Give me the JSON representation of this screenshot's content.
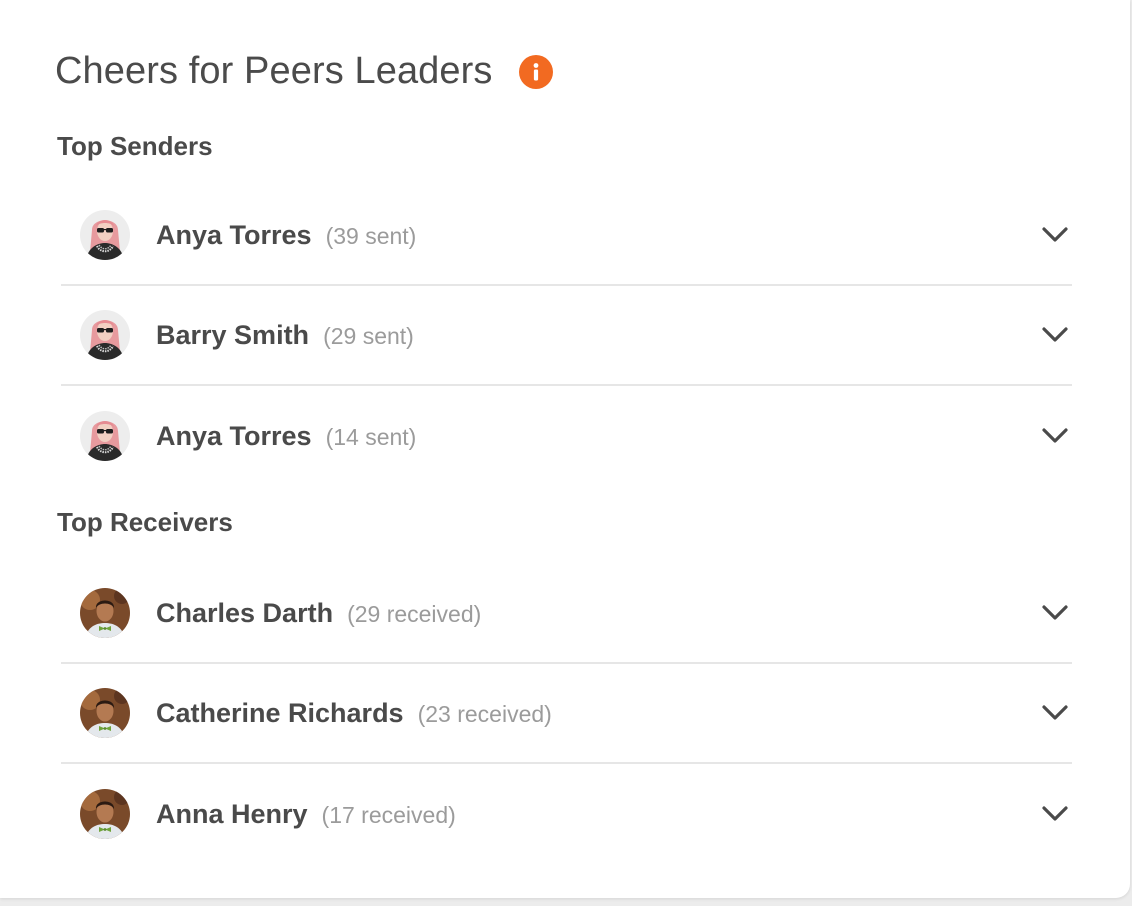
{
  "widget": {
    "title": "Cheers for Peers Leaders",
    "info_icon": "info-icon",
    "accent_color": "#f26a21"
  },
  "senders": {
    "heading": "Top Senders",
    "items": [
      {
        "name": "Anya Torres",
        "count": "(39 sent)",
        "avatar": "avatar-woman-pink-hair"
      },
      {
        "name": "Barry Smith",
        "count": "(29 sent)",
        "avatar": "avatar-woman-pink-hair"
      },
      {
        "name": "Anya Torres",
        "count": "(14 sent)",
        "avatar": "avatar-woman-pink-hair"
      }
    ]
  },
  "receivers": {
    "heading": "Top Receivers",
    "items": [
      {
        "name": "Charles Darth",
        "count": "(29 received)",
        "avatar": "avatar-man-bowtie"
      },
      {
        "name": "Catherine Richards",
        "count": "(23 received)",
        "avatar": "avatar-man-bowtie"
      },
      {
        "name": "Anna Henry",
        "count": "(17 received)",
        "avatar": "avatar-man-bowtie"
      }
    ]
  }
}
